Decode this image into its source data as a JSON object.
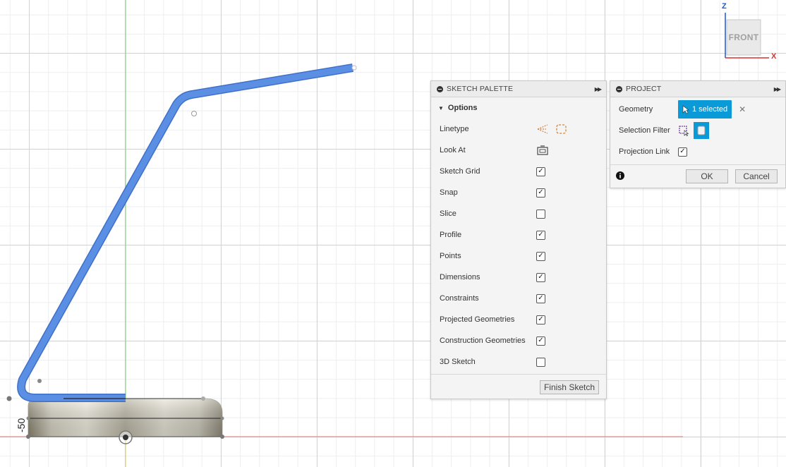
{
  "viewport": {
    "dimension_label": "-50"
  },
  "viewcube": {
    "face_label": "FRONT",
    "axis_z_label": "Z",
    "axis_x_label": "X",
    "axis_z_color": "#1a56d6",
    "axis_x_color": "#d83030"
  },
  "sketch_palette": {
    "title": "SKETCH PALETTE",
    "section_title": "Options",
    "options": [
      {
        "label": "Linetype",
        "control": "icons",
        "icons": [
          "linetype-icon",
          "construction-line-icon"
        ]
      },
      {
        "label": "Look At",
        "control": "icon",
        "icons": [
          "look-at-icon"
        ]
      },
      {
        "label": "Sketch Grid",
        "control": "checkbox",
        "checked": true
      },
      {
        "label": "Snap",
        "control": "checkbox",
        "checked": true
      },
      {
        "label": "Slice",
        "control": "checkbox",
        "checked": false
      },
      {
        "label": "Profile",
        "control": "checkbox",
        "checked": true
      },
      {
        "label": "Points",
        "control": "checkbox",
        "checked": true
      },
      {
        "label": "Dimensions",
        "control": "checkbox",
        "checked": true
      },
      {
        "label": "Constraints",
        "control": "checkbox",
        "checked": true
      },
      {
        "label": "Projected Geometries",
        "control": "checkbox",
        "checked": true
      },
      {
        "label": "Construction Geometries",
        "control": "checkbox",
        "checked": true
      },
      {
        "label": "3D Sketch",
        "control": "checkbox",
        "checked": false
      }
    ],
    "finish_button": "Finish Sketch"
  },
  "project_dialog": {
    "title": "PROJECT",
    "geometry_label": "Geometry",
    "geometry_value": "1 selected",
    "selection_filter_label": "Selection Filter",
    "projection_link_label": "Projection Link",
    "projection_link_checked": true,
    "ok_button": "OK",
    "cancel_button": "Cancel",
    "accent_color": "#0a9ad8"
  }
}
